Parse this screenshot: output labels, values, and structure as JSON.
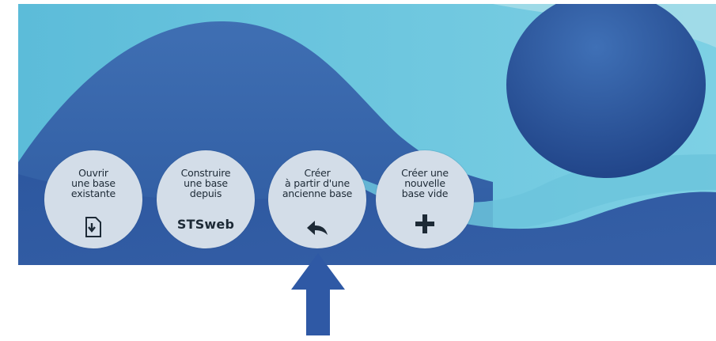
{
  "buttons": [
    {
      "label": "Ouvrir\nune base\nexistante",
      "icon": "open-file-icon"
    },
    {
      "label": "Construire\nune base\ndepuis",
      "brand": "STSweb"
    },
    {
      "label": "Créer\nà partir d'une\nancienne base",
      "icon": "reply-arrow-icon"
    },
    {
      "label": "Créer une\nnouvelle\nbase vide",
      "icon": "plus-icon"
    }
  ],
  "colors": {
    "sky": "#63c2dc",
    "wave": "#3a68ad",
    "deep": "#2b4f94",
    "button": "#d3dde8",
    "pointer_arrow": "#2f59a5"
  }
}
